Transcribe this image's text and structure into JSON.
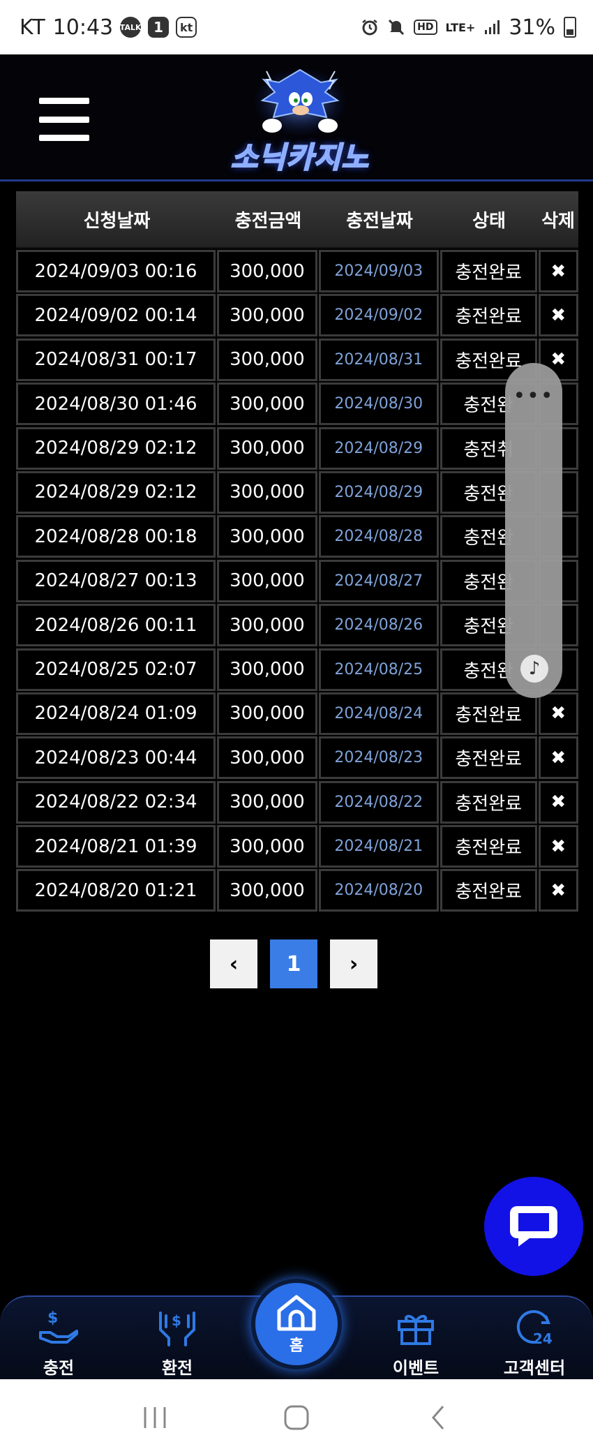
{
  "status_bar": {
    "carrier": "KT",
    "time": "10:43",
    "chip_talk": "TALK",
    "chip_one": "1",
    "chip_kt": "kt",
    "hd": "HD",
    "lte": "LTE+",
    "battery": "31%"
  },
  "header": {
    "logo_text": "소닉카지노"
  },
  "table": {
    "headers": [
      "신청날짜",
      "충전금액",
      "충전날짜",
      "상태",
      "삭제"
    ],
    "rows": [
      [
        "2024/09/03 00:16",
        "300,000",
        "2024/09/03",
        "충전완료",
        "✖"
      ],
      [
        "2024/09/02 00:14",
        "300,000",
        "2024/09/02",
        "충전완료",
        "✖"
      ],
      [
        "2024/08/31 00:17",
        "300,000",
        "2024/08/31",
        "충전완료",
        "✖"
      ],
      [
        "2024/08/30 01:46",
        "300,000",
        "2024/08/30",
        "충전완",
        ""
      ],
      [
        "2024/08/29 02:12",
        "300,000",
        "2024/08/29",
        "충전취",
        ""
      ],
      [
        "2024/08/29 02:12",
        "300,000",
        "2024/08/29",
        "충전완",
        ""
      ],
      [
        "2024/08/28 00:18",
        "300,000",
        "2024/08/28",
        "충전완",
        ""
      ],
      [
        "2024/08/27 00:13",
        "300,000",
        "2024/08/27",
        "충전완",
        ""
      ],
      [
        "2024/08/26 00:11",
        "300,000",
        "2024/08/26",
        "충전완",
        ""
      ],
      [
        "2024/08/25 02:07",
        "300,000",
        "2024/08/25",
        "충전완",
        ""
      ],
      [
        "2024/08/24 01:09",
        "300,000",
        "2024/08/24",
        "충전완료",
        "✖"
      ],
      [
        "2024/08/23 00:44",
        "300,000",
        "2024/08/23",
        "충전완료",
        "✖"
      ],
      [
        "2024/08/22 02:34",
        "300,000",
        "2024/08/22",
        "충전완료",
        "✖"
      ],
      [
        "2024/08/21 01:39",
        "300,000",
        "2024/08/21",
        "충전완료",
        "✖"
      ],
      [
        "2024/08/20 01:21",
        "300,000",
        "2024/08/20",
        "충전완료",
        "✖"
      ]
    ]
  },
  "pagination": {
    "prev": "‹",
    "current": "1",
    "next": "›"
  },
  "side_panel": {
    "dots": "•••",
    "note_icon": "music-note-icon"
  },
  "bottom_nav": {
    "charge": "충전",
    "exchange": "환전",
    "home": "홈",
    "event": "이벤트",
    "support": "고객센터"
  },
  "colors": {
    "accent": "#3b7de6",
    "chat": "#1212e6",
    "nav_bg": "#0b1530",
    "date_blue": "#7fa2d8"
  }
}
